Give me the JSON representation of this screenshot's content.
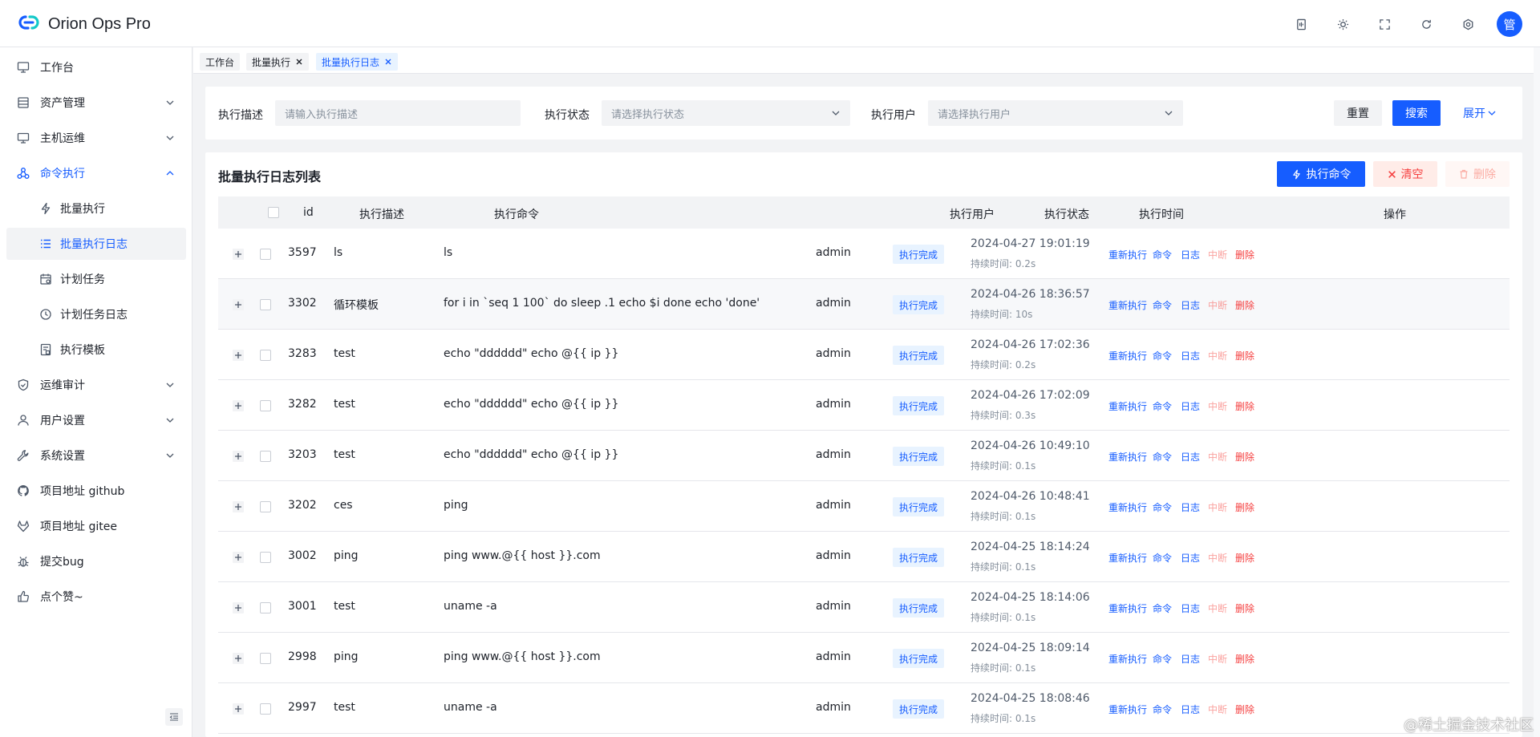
{
  "app": {
    "title": "Orion Ops Pro"
  },
  "header": {
    "icons": [
      "document-icon",
      "sun-icon",
      "fullscreen-icon",
      "refresh-icon",
      "settings-icon"
    ],
    "avatar": "管"
  },
  "sidebar": {
    "items": [
      {
        "label": "工作台",
        "icon": "dashboard-icon"
      },
      {
        "label": "资产管理",
        "icon": "asset-icon"
      },
      {
        "label": "主机运维",
        "icon": "monitor-icon"
      },
      {
        "label": "命令执行",
        "icon": "command-icon"
      },
      {
        "label": "运维审计",
        "icon": "shield-icon"
      },
      {
        "label": "用户设置",
        "icon": "user-icon"
      },
      {
        "label": "系统设置",
        "icon": "wrench-icon"
      },
      {
        "label": "项目地址 github",
        "icon": "github-icon"
      },
      {
        "label": "项目地址 gitee",
        "icon": "gitee-icon"
      },
      {
        "label": "提交bug",
        "icon": "bug-icon"
      },
      {
        "label": "点个赞~",
        "icon": "thumb-up-icon"
      }
    ],
    "sub_items": [
      {
        "label": "批量执行",
        "icon": "lightning-icon"
      },
      {
        "label": "批量执行日志",
        "icon": "list-icon"
      },
      {
        "label": "计划任务",
        "icon": "calendar-icon"
      },
      {
        "label": "计划任务日志",
        "icon": "history-icon"
      },
      {
        "label": "执行模板",
        "icon": "template-icon"
      }
    ]
  },
  "tabs": [
    {
      "label": "工作台"
    },
    {
      "label": "批量执行"
    },
    {
      "label": "批量执行日志"
    }
  ],
  "search": {
    "desc_label": "执行描述",
    "desc_placeholder": "请输入执行描述",
    "status_label": "执行状态",
    "status_placeholder": "请选择执行状态",
    "user_label": "执行用户",
    "user_placeholder": "请选择执行用户",
    "reset": "重置",
    "search": "搜索",
    "expand": "展开"
  },
  "table": {
    "title": "批量执行日志列表",
    "btn_exec": "执行命令",
    "btn_clear": "清空",
    "btn_delete": "删除",
    "columns": [
      "id",
      "执行描述",
      "执行命令",
      "执行用户",
      "执行状态",
      "执行时间",
      "操作"
    ],
    "actions": [
      "重新执行",
      "命令",
      "日志",
      "中断",
      "删除"
    ],
    "rows": [
      {
        "id": "3597",
        "desc": "ls",
        "cmd": "ls",
        "user": "admin",
        "status": "执行完成",
        "time": "2024-04-27 19:01:19",
        "duration": "持续时间: 0.2s"
      },
      {
        "id": "3302",
        "desc": "循环模板",
        "cmd": "for i in `seq 1 100` do sleep .1 echo $i done echo 'done'",
        "user": "admin",
        "status": "执行完成",
        "time": "2024-04-26 18:36:57",
        "duration": "持续时间: 10s"
      },
      {
        "id": "3283",
        "desc": "test",
        "cmd": "echo \"dddddd\" echo @{{ ip }}",
        "user": "admin",
        "status": "执行完成",
        "time": "2024-04-26 17:02:36",
        "duration": "持续时间: 0.2s"
      },
      {
        "id": "3282",
        "desc": "test",
        "cmd": "echo \"dddddd\" echo @{{ ip }}",
        "user": "admin",
        "status": "执行完成",
        "time": "2024-04-26 17:02:09",
        "duration": "持续时间: 0.3s"
      },
      {
        "id": "3203",
        "desc": "test",
        "cmd": "echo \"dddddd\" echo @{{ ip }}",
        "user": "admin",
        "status": "执行完成",
        "time": "2024-04-26 10:49:10",
        "duration": "持续时间: 0.1s"
      },
      {
        "id": "3202",
        "desc": "ces",
        "cmd": "ping",
        "user": "admin",
        "status": "执行完成",
        "time": "2024-04-26 10:48:41",
        "duration": "持续时间: 0.1s"
      },
      {
        "id": "3002",
        "desc": "ping",
        "cmd": "ping www.@{{ host }}.com",
        "user": "admin",
        "status": "执行完成",
        "time": "2024-04-25 18:14:24",
        "duration": "持续时间: 0.1s"
      },
      {
        "id": "3001",
        "desc": "test",
        "cmd": "uname -a",
        "user": "admin",
        "status": "执行完成",
        "time": "2024-04-25 18:14:06",
        "duration": "持续时间: 0.1s"
      },
      {
        "id": "2998",
        "desc": "ping",
        "cmd": "ping www.@{{ host }}.com",
        "user": "admin",
        "status": "执行完成",
        "time": "2024-04-25 18:09:14",
        "duration": "持续时间: 0.1s"
      },
      {
        "id": "2997",
        "desc": "test",
        "cmd": "uname -a",
        "user": "admin",
        "status": "执行完成",
        "time": "2024-04-25 18:08:46",
        "duration": "持续时间: 0.1s"
      }
    ]
  },
  "watermark": "@稀土掘金技术社区",
  "colors": {
    "primary": "#165dff",
    "danger": "#f53f3f",
    "background": "#f2f3f5"
  }
}
